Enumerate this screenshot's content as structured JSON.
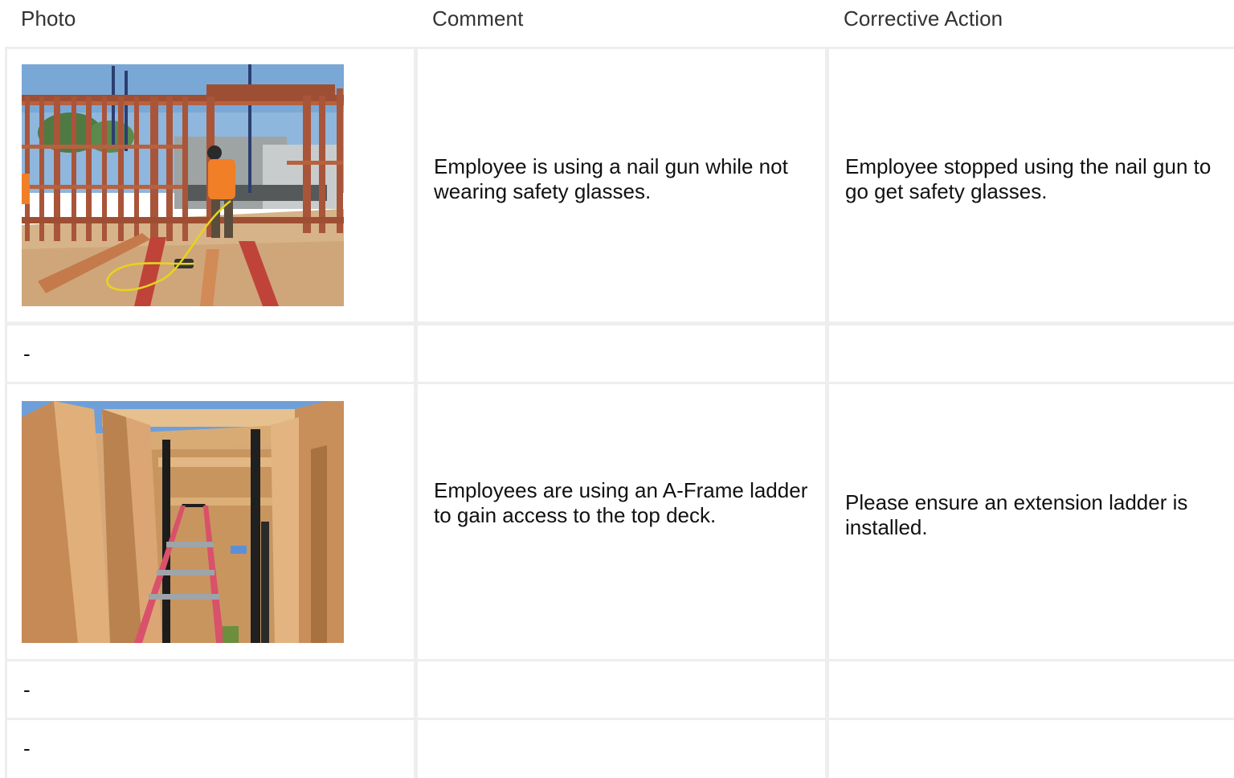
{
  "table": {
    "headers": {
      "photo": "Photo",
      "comment": "Comment",
      "corrective_action": "Corrective Action"
    },
    "rows": [
      {
        "photo": "construction-site-nail-gun-photo",
        "comment": "Employee is using a nail gun while not wearing safety glasses.",
        "corrective_action": "Employee stopped using the nail gun to go get safety glasses."
      },
      {
        "photo": "-",
        "comment": "",
        "corrective_action": ""
      },
      {
        "photo": "a-frame-ladder-photo",
        "comment": "Employees are using an A-Frame ladder to gain access to the top deck.",
        "corrective_action": "Please ensure an extension ladder is installed."
      },
      {
        "photo": "-",
        "comment": "",
        "corrective_action": ""
      },
      {
        "photo": "-",
        "comment": "",
        "corrective_action": ""
      }
    ]
  }
}
